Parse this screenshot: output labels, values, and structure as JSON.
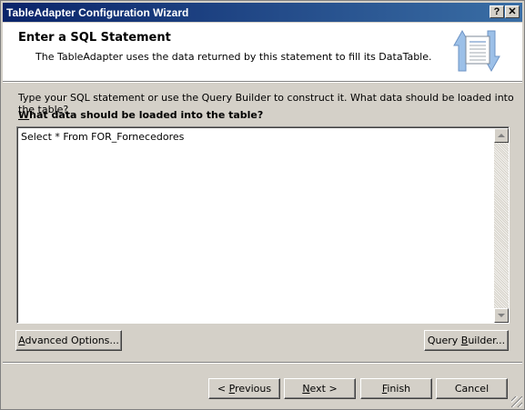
{
  "window": {
    "title": "TableAdapter Configuration Wizard",
    "help_label": "?",
    "close_label": "✕"
  },
  "header": {
    "title": "Enter a SQL Statement",
    "description": "The TableAdapter uses the data returned by this statement to fill its DataTable.",
    "icon": "data-transfer-icon"
  },
  "body": {
    "instruction": "Type your SQL statement or use the Query Builder to construct it. What data should be loaded into the table?",
    "question_accel": "W",
    "question_rest": "hat data should be loaded into the table?",
    "sql_text": "Select * From FOR_Fornecedores"
  },
  "buttons": {
    "advanced_accel": "A",
    "advanced_rest": "dvanced Options...",
    "query_pre": "Query ",
    "query_accel": "B",
    "query_rest": "uilder...",
    "previous_pre": "< ",
    "previous_accel": "P",
    "previous_rest": "revious",
    "next_accel": "N",
    "next_rest": "ext >",
    "finish_accel": "F",
    "finish_rest": "inish",
    "cancel": "Cancel"
  },
  "colors": {
    "titlebar_start": "#0a246a",
    "titlebar_end": "#3a6ea5",
    "face": "#d4d0c8"
  }
}
